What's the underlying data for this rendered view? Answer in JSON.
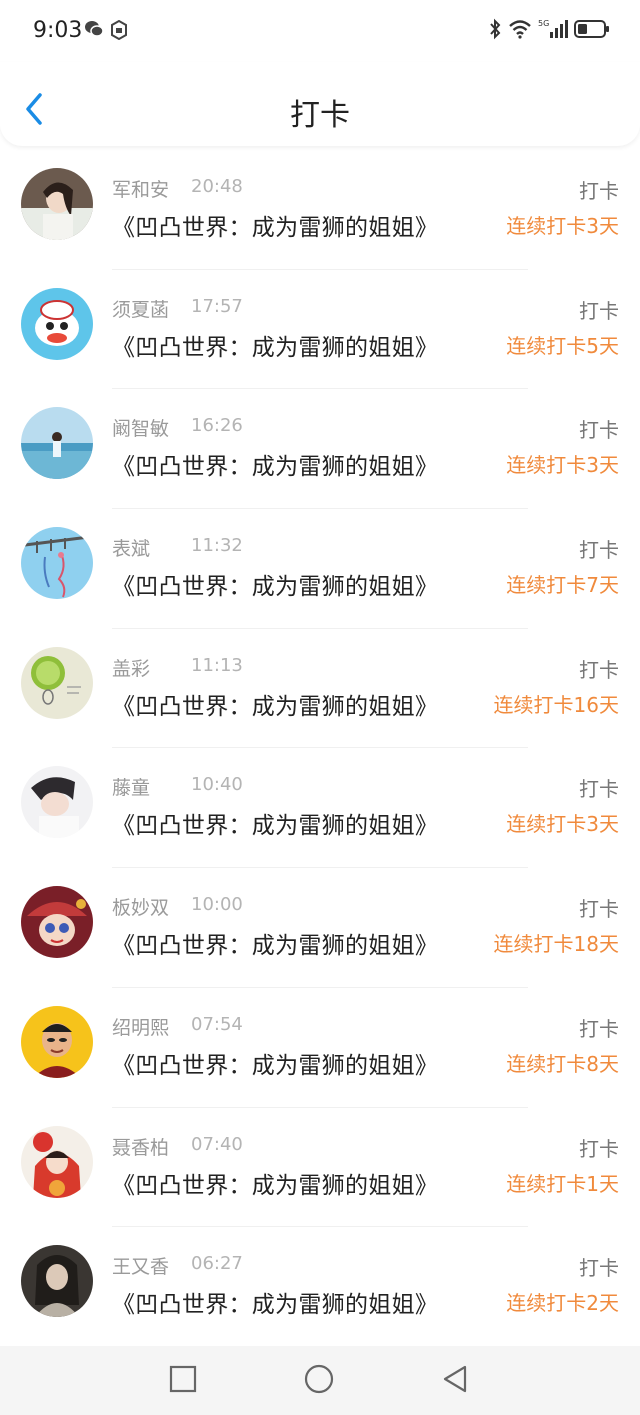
{
  "status": {
    "time": "9:03"
  },
  "header": {
    "title": "打卡"
  },
  "colors": {
    "accent": "#1a8ce5",
    "streak": "#f08a3c"
  },
  "items": [
    {
      "name": "军和安",
      "time": "20:48",
      "book": "《凹凸世界：成为雷狮的姐姐》",
      "action": "打卡",
      "streak": "连续打卡3天"
    },
    {
      "name": "须夏菡",
      "time": "17:57",
      "book": "《凹凸世界：成为雷狮的姐姐》",
      "action": "打卡",
      "streak": "连续打卡5天"
    },
    {
      "name": "阚智敏",
      "time": "16:26",
      "book": "《凹凸世界：成为雷狮的姐姐》",
      "action": "打卡",
      "streak": "连续打卡3天"
    },
    {
      "name": "表斌",
      "time": "11:32",
      "book": "《凹凸世界：成为雷狮的姐姐》",
      "action": "打卡",
      "streak": "连续打卡7天"
    },
    {
      "name": "盖彩",
      "time": "11:13",
      "book": "《凹凸世界：成为雷狮的姐姐》",
      "action": "打卡",
      "streak": "连续打卡16天"
    },
    {
      "name": "藤童",
      "time": "10:40",
      "book": "《凹凸世界：成为雷狮的姐姐》",
      "action": "打卡",
      "streak": "连续打卡3天"
    },
    {
      "name": "板妙双",
      "time": "10:00",
      "book": "《凹凸世界：成为雷狮的姐姐》",
      "action": "打卡",
      "streak": "连续打卡18天"
    },
    {
      "name": "绍明熙",
      "time": "07:54",
      "book": "《凹凸世界：成为雷狮的姐姐》",
      "action": "打卡",
      "streak": "连续打卡8天"
    },
    {
      "name": "聂香柏",
      "time": "07:40",
      "book": "《凹凸世界：成为雷狮的姐姐》",
      "action": "打卡",
      "streak": "连续打卡1天"
    },
    {
      "name": "王又香",
      "time": "06:27",
      "book": "《凹凸世界：成为雷狮的姐姐》",
      "action": "打卡",
      "streak": "连续打卡2天"
    }
  ],
  "icons": {
    "status_left": [
      "wechat-icon",
      "app-notification-icon"
    ],
    "status_right": [
      "bluetooth-icon",
      "wifi-icon",
      "5g-signal-icon",
      "battery-icon"
    ],
    "nav": [
      "recent-apps-icon",
      "home-icon",
      "back-nav-icon"
    ]
  }
}
